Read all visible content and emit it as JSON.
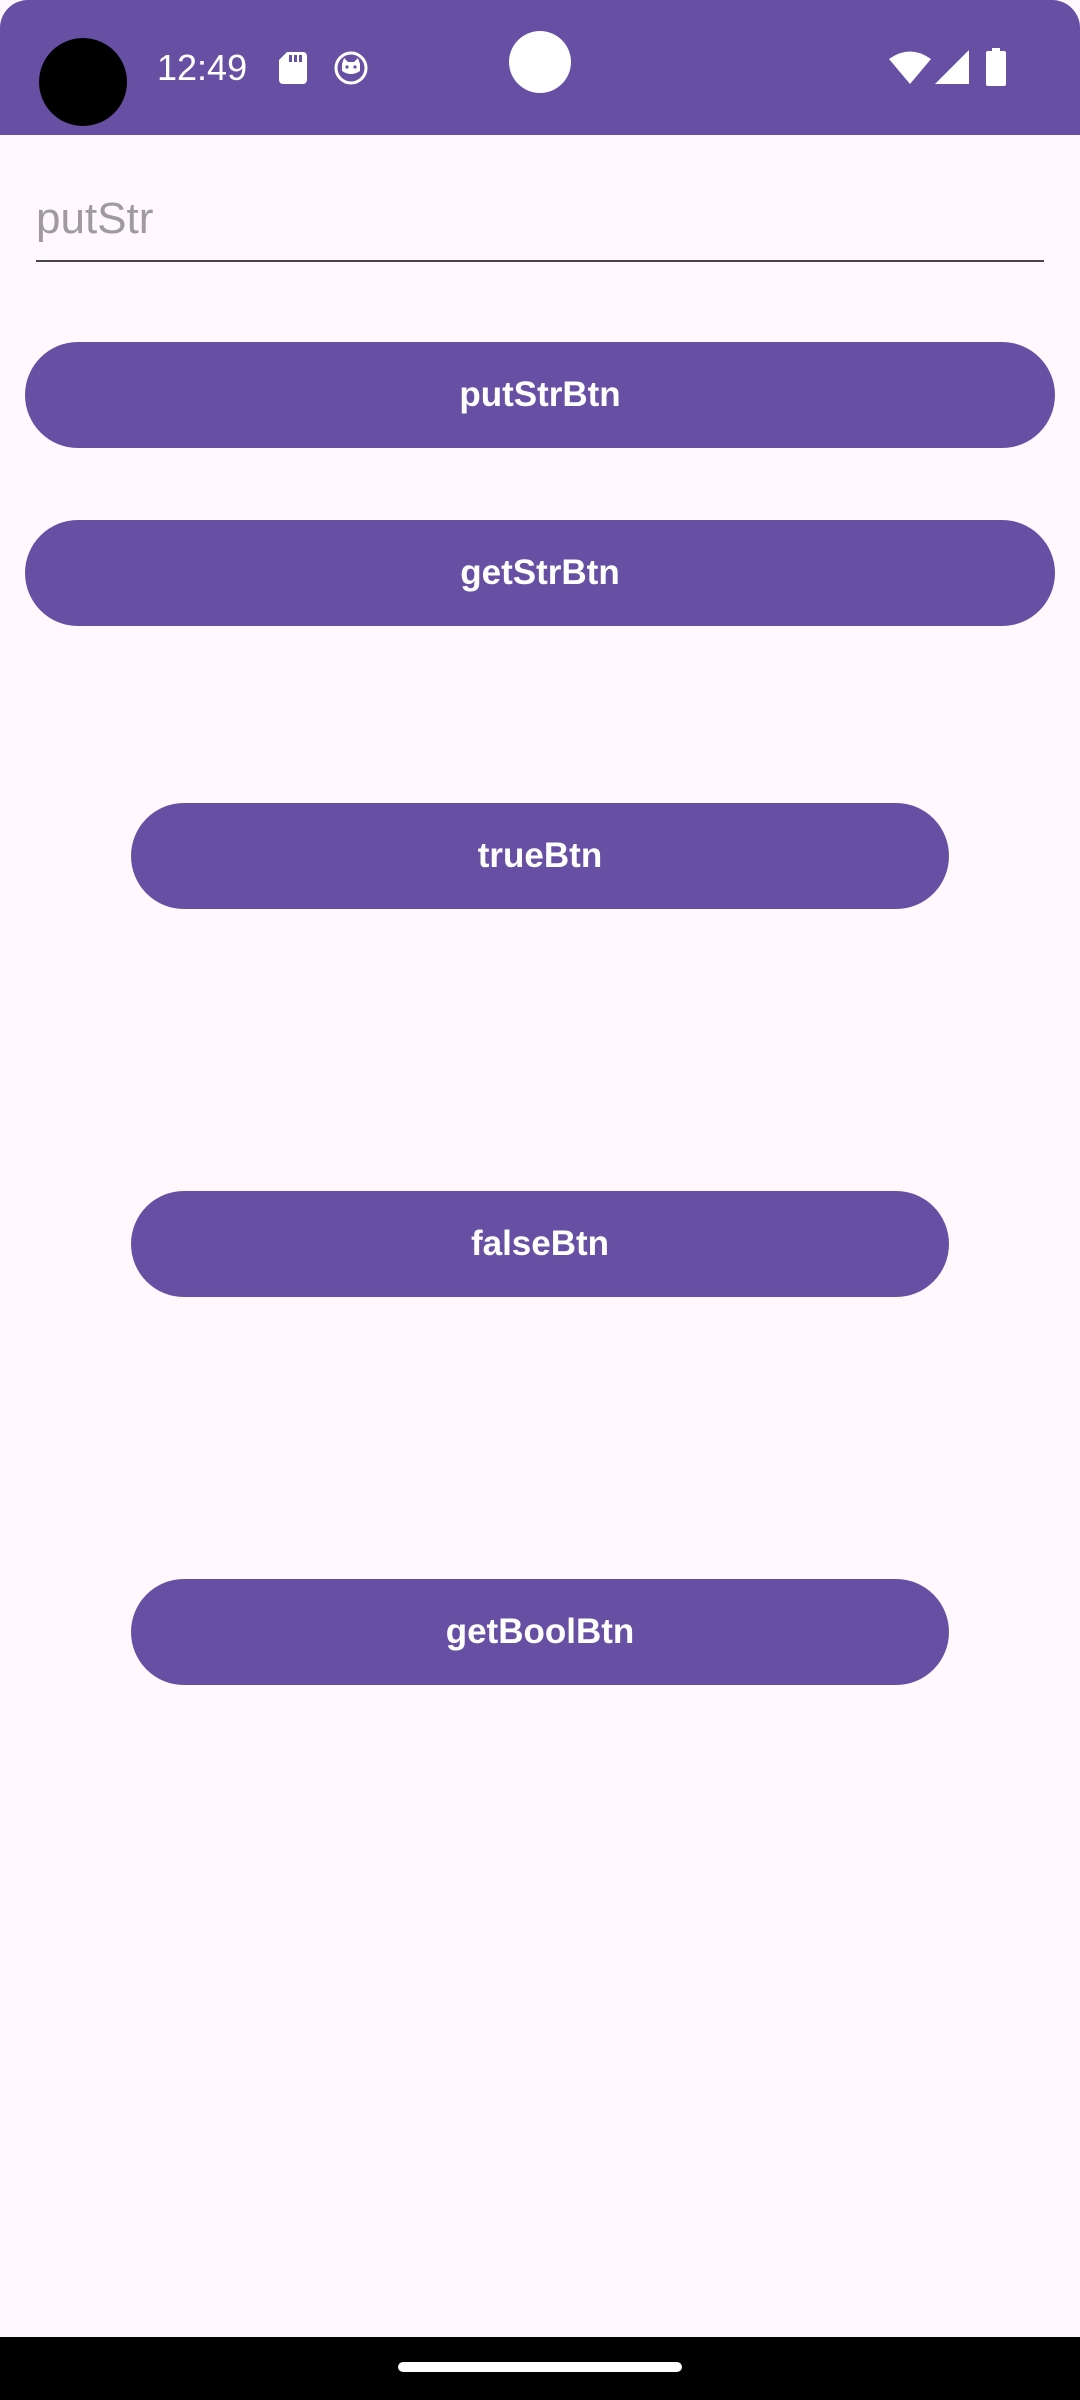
{
  "status_bar": {
    "time": "12:49",
    "icons": [
      "camera-cutout",
      "sd-card-icon",
      "cat-icon",
      "center-dot",
      "wifi-icon",
      "signal-icon",
      "battery-icon"
    ],
    "background_color": "#6750A4"
  },
  "input": {
    "placeholder": "putStr",
    "value": ""
  },
  "buttons": {
    "put_str": "putStrBtn",
    "get_str": "getStrBtn",
    "true_btn": "trueBtn",
    "false_btn": "falseBtn",
    "get_bool": "getBoolBtn"
  },
  "colors": {
    "primary": "#6750A4",
    "background": "#FFF8FC",
    "on_primary": "#FFFFFF"
  }
}
